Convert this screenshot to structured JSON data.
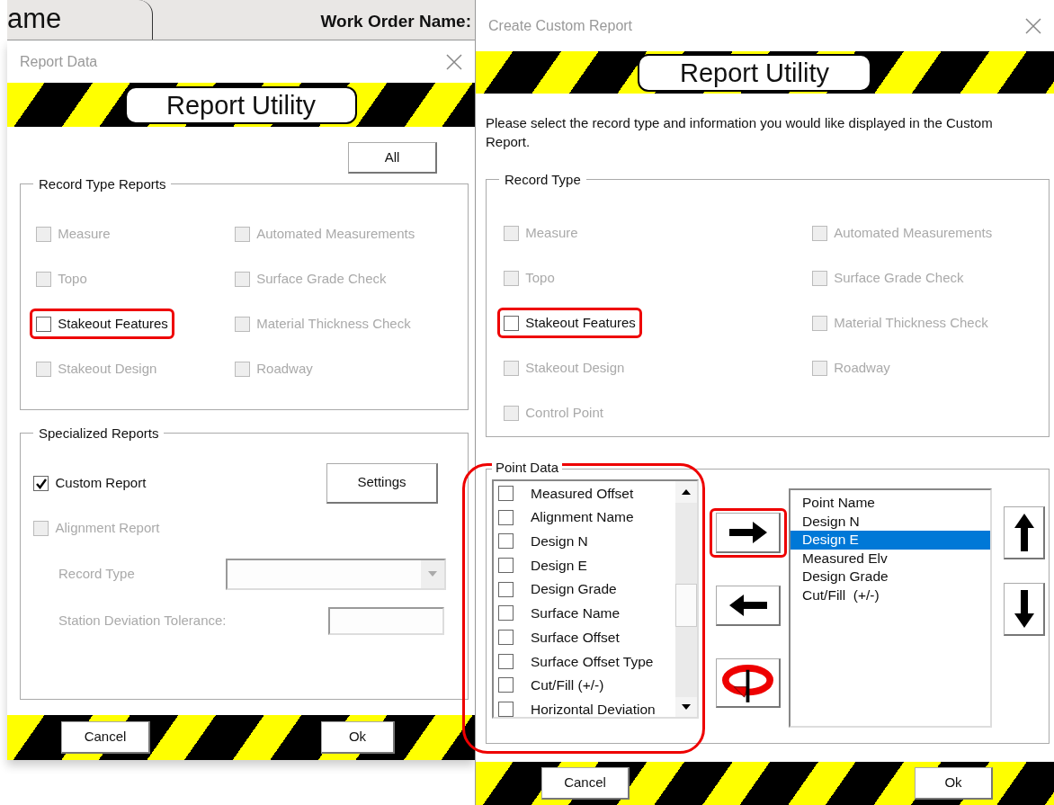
{
  "background": {
    "tab_label": "ame",
    "field_label": "Work Order Name:"
  },
  "report_data_dialog": {
    "title": "Report Data",
    "banner_title": "Report Utility",
    "all_button": "All",
    "record_type_group": {
      "legend": "Record Type Reports",
      "options": [
        {
          "label": "Measure",
          "checked": false,
          "disabled": true,
          "highlighted": false
        },
        {
          "label": "Automated Measurements",
          "checked": false,
          "disabled": true,
          "highlighted": false
        },
        {
          "label": "Topo",
          "checked": false,
          "disabled": true,
          "highlighted": false
        },
        {
          "label": "Surface Grade Check",
          "checked": false,
          "disabled": true,
          "highlighted": false
        },
        {
          "label": "Stakeout Features",
          "checked": false,
          "disabled": false,
          "highlighted": true
        },
        {
          "label": "Material Thickness Check",
          "checked": false,
          "disabled": true,
          "highlighted": false
        },
        {
          "label": "Stakeout Design",
          "checked": false,
          "disabled": true,
          "highlighted": false
        },
        {
          "label": "Roadway",
          "checked": false,
          "disabled": true,
          "highlighted": false
        }
      ]
    },
    "specialized_group": {
      "legend": "Specialized Reports",
      "options": [
        {
          "label": "Custom Report",
          "checked": true,
          "disabled": false
        },
        {
          "label": "Alignment Report",
          "checked": false,
          "disabled": true
        }
      ],
      "settings_button": "Settings",
      "alignment_fields": {
        "disabled": true,
        "record_type_label": "Record Type",
        "tolerance_label": "Station Deviation Tolerance:"
      }
    },
    "buttons": [
      "Cancel",
      "Ok"
    ]
  },
  "custom_report_dialog": {
    "title": "Create Custom Report",
    "banner_title": "Report Utility",
    "description": "Please select the record type and information you would like displayed in the Custom Report.",
    "record_type_group": {
      "legend": "Record Type",
      "options": [
        {
          "label": "Measure",
          "checked": false,
          "disabled": true,
          "highlighted": false
        },
        {
          "label": "Automated Measurements",
          "checked": false,
          "disabled": true,
          "highlighted": false
        },
        {
          "label": "Topo",
          "checked": false,
          "disabled": true,
          "highlighted": false
        },
        {
          "label": "Surface Grade Check",
          "checked": false,
          "disabled": true,
          "highlighted": false
        },
        {
          "label": "Stakeout Features",
          "checked": false,
          "disabled": false,
          "highlighted": true
        },
        {
          "label": "Material Thickness Check",
          "checked": false,
          "disabled": true,
          "highlighted": false
        },
        {
          "label": "Stakeout Design",
          "checked": false,
          "disabled": true,
          "highlighted": false
        },
        {
          "label": "Roadway",
          "checked": false,
          "disabled": true,
          "highlighted": false
        },
        {
          "label": "Control Point",
          "checked": false,
          "disabled": true,
          "highlighted": false
        }
      ]
    },
    "point_data_group": {
      "legend": "Point Data",
      "highlighted": true,
      "available_fields": [
        {
          "label": "Measured Offset",
          "checked": false
        },
        {
          "label": "Alignment Name",
          "checked": false
        },
        {
          "label": "Design N",
          "checked": false
        },
        {
          "label": "Design E",
          "checked": false
        },
        {
          "label": "Design Grade",
          "checked": false
        },
        {
          "label": "Surface Name",
          "checked": false
        },
        {
          "label": "Surface Offset",
          "checked": false
        },
        {
          "label": "Surface Offset Type",
          "checked": false
        },
        {
          "label": "Cut/Fill  (+/-)",
          "checked": false
        },
        {
          "label": "Horizontal Deviation",
          "checked": false
        }
      ],
      "move_buttons": [
        {
          "kind": "add",
          "highlighted": true
        },
        {
          "kind": "remove",
          "highlighted": false
        },
        {
          "kind": "reset",
          "highlighted": false
        }
      ],
      "selected_fields": [
        {
          "label": "Point Name",
          "selected": false
        },
        {
          "label": "Design N",
          "selected": false
        },
        {
          "label": "Design E",
          "selected": true
        },
        {
          "label": "Measured Elv",
          "selected": false
        },
        {
          "label": "Design Grade",
          "selected": false
        },
        {
          "label": "Cut/Fill  (+/-)",
          "selected": false
        }
      ],
      "order_buttons": [
        {
          "kind": "up"
        },
        {
          "kind": "down"
        }
      ]
    },
    "buttons": [
      "Cancel",
      "Ok"
    ]
  }
}
